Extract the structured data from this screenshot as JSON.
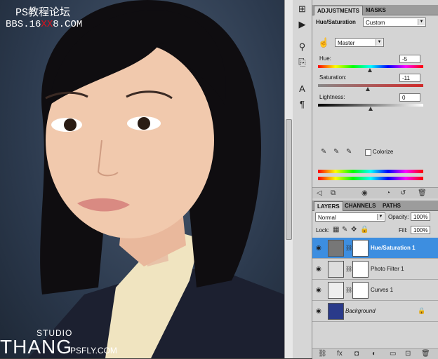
{
  "watermark": {
    "line1": "PS教程论坛",
    "line2_a": "BBS.16",
    "line2_b": "XX",
    "line2_c": "8.COM"
  },
  "signature": {
    "studio": "STUDIO",
    "thang": "THANG",
    "site": "PSFLY.COM"
  },
  "adjustments": {
    "tab_adjustments": "ADJUSTMENTS",
    "tab_masks": "MASKS",
    "title": "Hue/Saturation",
    "preset": "Custom",
    "channel": "Master",
    "hue_label": "Hue:",
    "hue_value": "-5",
    "saturation_label": "Saturation:",
    "saturation_value": "-11",
    "lightness_label": "Lightness:",
    "lightness_value": "0",
    "colorize_label": "Colorize",
    "hue_fraction": 0.49,
    "saturation_fraction": 0.47,
    "lightness_fraction": 0.5
  },
  "layers_panel": {
    "tab_layers": "LAYERS",
    "tab_channels": "CHANNELS",
    "tab_paths": "PATHS",
    "blend_mode": "Normal",
    "opacity_label": "Opacity:",
    "opacity_value": "100%",
    "lock_label": "Lock:",
    "fill_label": "Fill:",
    "fill_value": "100%",
    "layers": [
      {
        "name": "Hue/Saturation 1",
        "selected": true
      },
      {
        "name": "Photo Filter 1",
        "selected": false
      },
      {
        "name": "Curves 1",
        "selected": false
      },
      {
        "name": "Background",
        "selected": false
      }
    ]
  },
  "colors": {
    "selection": "#3d8ee0",
    "watermark_red": "#e0101a"
  }
}
